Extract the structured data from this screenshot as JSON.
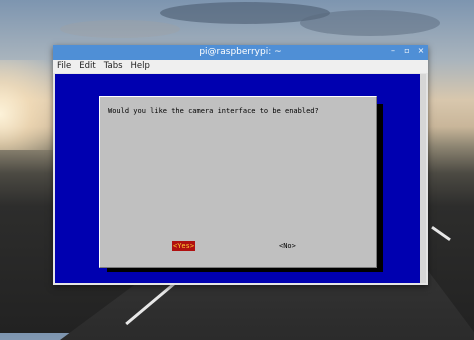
{
  "window": {
    "title": "pi@raspberrypi: ~"
  },
  "menu": [
    "File",
    "Edit",
    "Tabs",
    "Help"
  ],
  "dialog": {
    "question": "Would you like the camera interface to be enabled?",
    "yes_label": "<Yes>",
    "no_label": "<No>"
  },
  "colors": {
    "terminal_bg": "#0000b0",
    "dialog_bg": "#c0c0c0",
    "selected_bg": "#b01010",
    "titlebar": "#4f8fd6"
  },
  "icons": [
    "minimize-icon",
    "maximize-icon",
    "close-icon"
  ]
}
